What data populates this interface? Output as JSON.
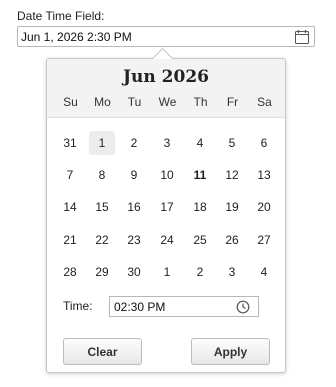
{
  "field": {
    "label": "Date Time Field:",
    "value": "Jun 1, 2026 2:30 PM",
    "icon": "calendar-icon"
  },
  "calendar": {
    "month_title": "Jun 2026",
    "weekdays": [
      "Su",
      "Mo",
      "Tu",
      "We",
      "Th",
      "Fr",
      "Sa"
    ],
    "weeks": [
      [
        "31",
        "1",
        "2",
        "3",
        "4",
        "5",
        "6"
      ],
      [
        "7",
        "8",
        "9",
        "10",
        "11",
        "12",
        "13"
      ],
      [
        "14",
        "15",
        "16",
        "17",
        "18",
        "19",
        "20"
      ],
      [
        "21",
        "22",
        "23",
        "24",
        "25",
        "26",
        "27"
      ],
      [
        "28",
        "29",
        "30",
        "1",
        "2",
        "3",
        "4"
      ]
    ],
    "selected_day": "1",
    "today_day": "11"
  },
  "time": {
    "label": "Time:",
    "value": "02:30 PM",
    "icon": "clock-icon"
  },
  "buttons": {
    "clear": "Clear",
    "apply": "Apply"
  }
}
